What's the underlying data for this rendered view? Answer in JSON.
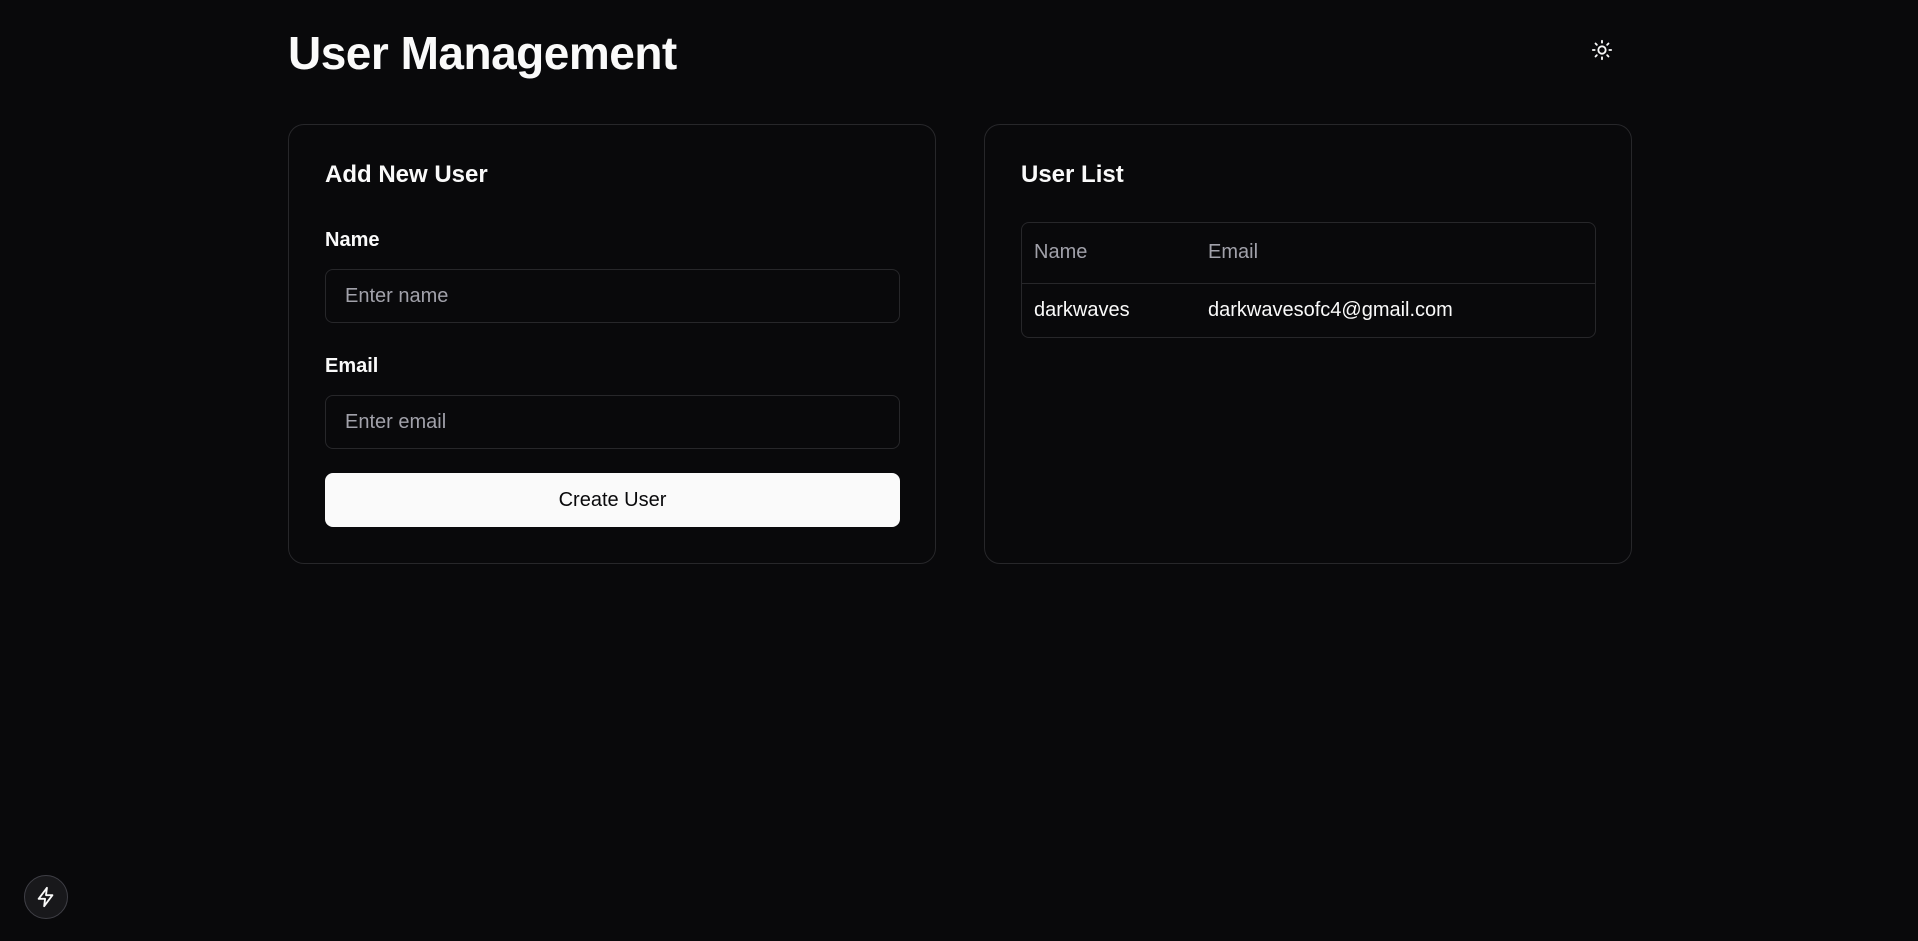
{
  "header": {
    "title": "User Management",
    "theme_toggle_icon": "sun-icon"
  },
  "add_user_form": {
    "title": "Add New User",
    "name_label": "Name",
    "name_placeholder": "Enter name",
    "name_value": "",
    "email_label": "Email",
    "email_placeholder": "Enter email",
    "email_value": "",
    "submit_label": "Create User"
  },
  "user_list": {
    "title": "User List",
    "columns": [
      "Name",
      "Email"
    ],
    "rows": [
      {
        "name": "darkwaves",
        "email": "darkwavesofc4@gmail.com"
      }
    ]
  },
  "floating_button": {
    "icon": "bolt-icon"
  },
  "colors": {
    "background": "#09090b",
    "border": "#27272a",
    "text": "#fafafa",
    "muted_text": "#a1a1aa",
    "button_bg": "#fafafa"
  }
}
